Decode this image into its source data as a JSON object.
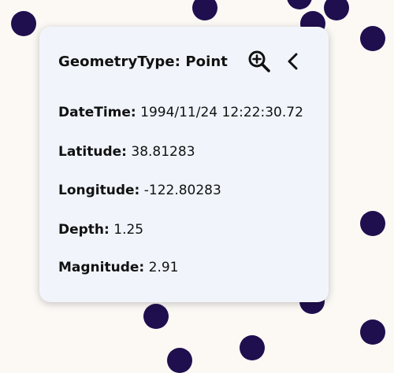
{
  "colors": {
    "map_background": "#fcf9f5",
    "point_fill": "#1f0f4e",
    "popup_background": "#f1f5fb",
    "text": "#111111"
  },
  "popup": {
    "title": "GeometryType: Point",
    "actions": {
      "zoom_icon": "zoom-in-icon",
      "back_icon": "chevron-left-icon"
    },
    "attributes": [
      {
        "key": "DateTime:",
        "value": "1994/11/24 12:22:30.72"
      },
      {
        "key": "Latitude:",
        "value": "38.81283"
      },
      {
        "key": "Longitude:",
        "value": "-122.80283"
      },
      {
        "key": "Depth:",
        "value": "1.25"
      },
      {
        "key": "Magnitude:",
        "value": "2.91"
      }
    ]
  }
}
